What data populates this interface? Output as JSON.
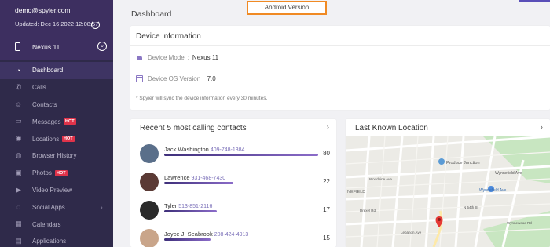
{
  "account": {
    "email": "demo@spyier.com",
    "updated": "Updated: Dec 16 2022 12:08:57"
  },
  "device": {
    "name": "Nexus 11"
  },
  "nav": [
    {
      "label": "Dashboard",
      "icon": "dashboard-icon",
      "active": true
    },
    {
      "label": "Calls",
      "icon": "phone-icon"
    },
    {
      "label": "Contacts",
      "icon": "contacts-icon"
    },
    {
      "label": "Messages",
      "icon": "chat-icon",
      "badge": "HOT"
    },
    {
      "label": "Locations",
      "icon": "location-pin-icon",
      "badge": "HOT"
    },
    {
      "label": "Browser History",
      "icon": "globe-icon"
    },
    {
      "label": "Photos",
      "icon": "image-icon",
      "badge": "HOT"
    },
    {
      "label": "Video Preview",
      "icon": "video-icon"
    },
    {
      "label": "Social Apps",
      "icon": "social-icon",
      "arrow": "›"
    },
    {
      "label": "Calendars",
      "icon": "calendar-icon"
    },
    {
      "label": "Applications",
      "icon": "apps-icon"
    }
  ],
  "tooltip": "Android Version",
  "page_title": "Dashboard",
  "device_info": {
    "title": "Device information",
    "model_label": "Device Model :",
    "model_value": "Nexus 11",
    "os_label": "Device OS Version :",
    "os_value": "7.0",
    "note": "* Spyier will sync the device information every 30 minutes."
  },
  "contacts_card": {
    "title": "Recent 5 most calling contacts",
    "arrow": "›",
    "items": [
      {
        "name": "Jack Washington",
        "phone": "409-748-1384",
        "count": "80",
        "fraction": 1.0,
        "avatar_color": "#5a6f8a"
      },
      {
        "name": "Lawrence",
        "phone": "931-468-7430",
        "count": "22",
        "fraction": 0.45,
        "avatar_color": "#5b3a35"
      },
      {
        "name": "Tyler",
        "phone": "513-851-2116",
        "count": "17",
        "fraction": 0.34,
        "avatar_color": "#2b2b2b"
      },
      {
        "name": "Joyce J. Seabrook",
        "phone": "208-424-4913",
        "count": "15",
        "fraction": 0.3,
        "avatar_color": "#c9a58a"
      }
    ]
  },
  "location_card": {
    "title": "Last Known Location",
    "arrow": "›",
    "map_labels": {
      "produce": "Produce Junction",
      "wynnefield_ave": "Wynnefield Ave",
      "wynnefield_rd": "Wynnefield Ave",
      "nefield": "NEFIELD",
      "woodbine": "Woodbine Ave",
      "drexel": "Drexel Rd",
      "lebanon": "Lebanon Ave",
      "wynnefield_plaza": "Wynnefield Ave",
      "n54": "N 54th St",
      "n56": "N 56th St",
      "wynnewood": "Wynnewood Rd"
    }
  }
}
